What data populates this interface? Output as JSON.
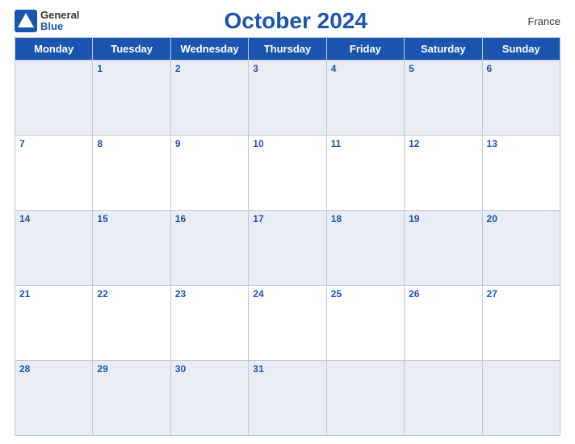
{
  "header": {
    "logo_general": "General",
    "logo_blue": "Blue",
    "month_title": "October 2024",
    "country": "France"
  },
  "calendar": {
    "days_of_week": [
      "Monday",
      "Tuesday",
      "Wednesday",
      "Thursday",
      "Friday",
      "Saturday",
      "Sunday"
    ],
    "weeks": [
      [
        "",
        "1",
        "2",
        "3",
        "4",
        "5",
        "6"
      ],
      [
        "7",
        "8",
        "9",
        "10",
        "11",
        "12",
        "13"
      ],
      [
        "14",
        "15",
        "16",
        "17",
        "18",
        "19",
        "20"
      ],
      [
        "21",
        "22",
        "23",
        "24",
        "25",
        "26",
        "27"
      ],
      [
        "28",
        "29",
        "30",
        "31",
        "",
        "",
        ""
      ]
    ]
  }
}
